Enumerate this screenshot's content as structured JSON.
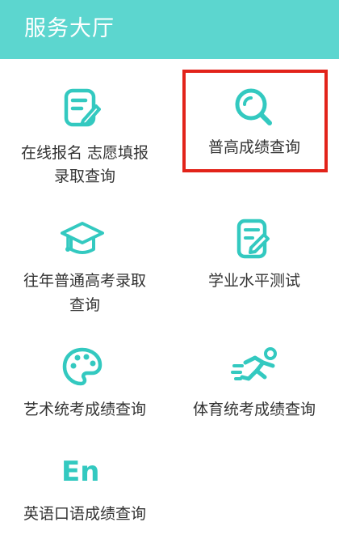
{
  "header": {
    "title": "服务大厅"
  },
  "colors": {
    "header_bg": "#5cd6cf",
    "icon": "#33c9c0",
    "text": "#333333",
    "highlight_border": "#e2231a"
  },
  "tiles": [
    {
      "icon": "pencil-document-icon",
      "label_line1": "在线报名 志愿填报",
      "label_line2": "录取查询"
    },
    {
      "icon": "magnifier-icon",
      "label_line1": "普高成绩查询",
      "label_line2": ""
    },
    {
      "icon": "graduation-cap-icon",
      "label_line1": "往年普通高考录取",
      "label_line2": "查询"
    },
    {
      "icon": "checklist-document-icon",
      "label_line1": "学业水平测试",
      "label_line2": ""
    },
    {
      "icon": "palette-icon",
      "label_line1": "艺术统考成绩查询",
      "label_line2": ""
    },
    {
      "icon": "runner-icon",
      "label_line1": "体育统考成绩查询",
      "label_line2": ""
    },
    {
      "icon": "en-text-icon",
      "icon_text": "En",
      "label_line1": "英语口语成绩查询",
      "label_line2": ""
    }
  ],
  "selected_tile": "普高成绩查询"
}
